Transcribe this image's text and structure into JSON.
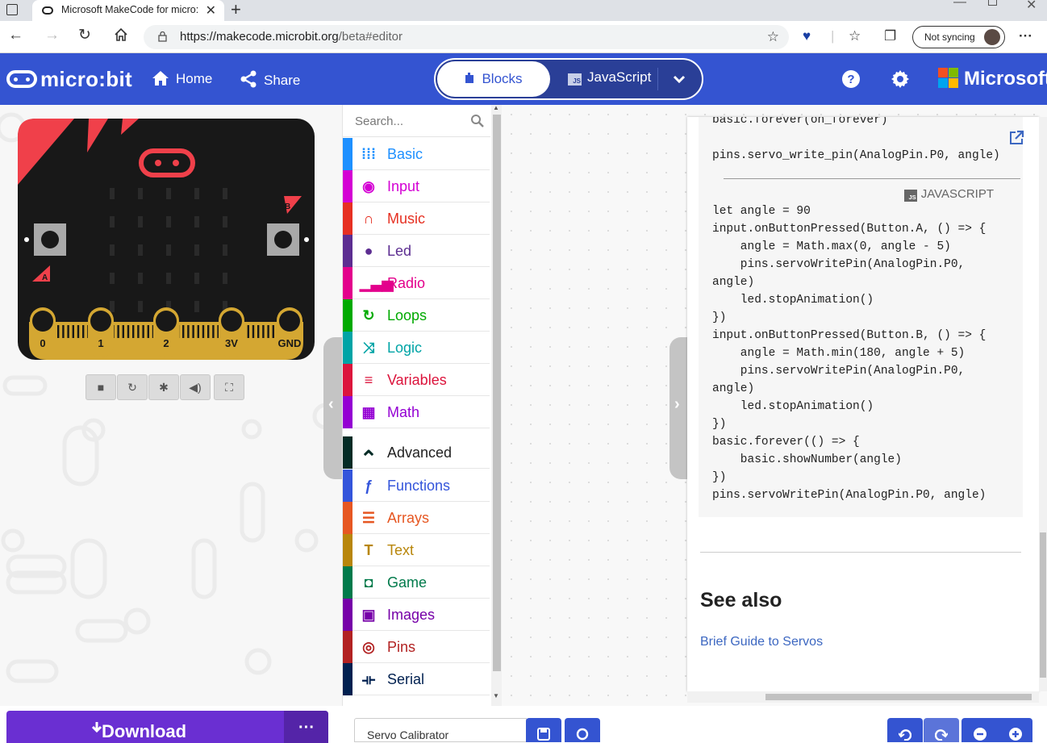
{
  "browser": {
    "tab_title": "Microsoft MakeCode for micro:bit",
    "url_host": "https://makecode.microbit.org",
    "url_path": "/beta#editor",
    "sync_label": "Not syncing"
  },
  "header": {
    "logo": "micro:bit",
    "home": "Home",
    "share": "Share",
    "blocks": "Blocks",
    "javascript": "JavaScript",
    "js_badge": "JS",
    "brand": "Microsoft"
  },
  "simulator": {
    "pins": [
      "0",
      "1",
      "2",
      "3V",
      "GND"
    ],
    "button_a": "A",
    "button_b": "B"
  },
  "toolbox": {
    "search_placeholder": "Search...",
    "categories": [
      {
        "label": "Basic",
        "color": "#1e90ff",
        "icon": "grid-icon"
      },
      {
        "label": "Input",
        "color": "#d400d4",
        "icon": "target-icon"
      },
      {
        "label": "Music",
        "color": "#e63022",
        "icon": "headphones-icon"
      },
      {
        "label": "Led",
        "color": "#5c2d91",
        "icon": "toggle-icon"
      },
      {
        "label": "Radio",
        "color": "#e3008c",
        "icon": "signal-icon"
      },
      {
        "label": "Loops",
        "color": "#00aa00",
        "icon": "refresh-icon"
      },
      {
        "label": "Logic",
        "color": "#00a4a6",
        "icon": "shuffle-icon"
      },
      {
        "label": "Variables",
        "color": "#dc143c",
        "icon": "lines-icon"
      },
      {
        "label": "Math",
        "color": "#9400d3",
        "icon": "calculator-icon"
      }
    ],
    "advanced": {
      "label": "Advanced",
      "color": "#042b25"
    },
    "advanced_categories": [
      {
        "label": "Functions",
        "color": "#3455db",
        "icon": "function-icon"
      },
      {
        "label": "Arrays",
        "color": "#e65722",
        "icon": "list-icon"
      },
      {
        "label": "Text",
        "color": "#b8860b",
        "icon": "text-icon"
      },
      {
        "label": "Game",
        "color": "#007a4b",
        "icon": "gamepad-icon"
      },
      {
        "label": "Images",
        "color": "#7600a8",
        "icon": "image-icon"
      },
      {
        "label": "Pins",
        "color": "#b22222",
        "icon": "bullseye-icon"
      },
      {
        "label": "Serial",
        "color": "#002050",
        "icon": "usb-icon"
      }
    ]
  },
  "help": {
    "python_lines": [
      "basic.forever(on_forever)",
      "",
      "pins.servo_write_pin(AnalogPin.P0, angle)"
    ],
    "js_badge": "JS",
    "js_label": "JAVASCRIPT",
    "js_lines": [
      "let angle = 90",
      "input.onButtonPressed(Button.A, () => {",
      "    angle = Math.max(0, angle - 5)",
      "    pins.servoWritePin(AnalogPin.P0,",
      "angle)",
      "    led.stopAnimation()",
      "})",
      "input.onButtonPressed(Button.B, () => {",
      "    angle = Math.min(180, angle + 5)",
      "    pins.servoWritePin(AnalogPin.P0,",
      "angle)",
      "    led.stopAnimation()",
      "})",
      "basic.forever(() => {",
      "    basic.showNumber(angle)",
      "})",
      "pins.servoWritePin(AnalogPin.P0, angle)"
    ],
    "see_also": "See also",
    "link": "Brief Guide to Servos"
  },
  "footer": {
    "download": "Download",
    "project_name": "Servo Calibrator"
  },
  "colors": {
    "header_blue": "#3454d1",
    "download_purple": "#6a2fd2",
    "board_red": "#f0404a",
    "pin_gold": "#d4a732"
  }
}
